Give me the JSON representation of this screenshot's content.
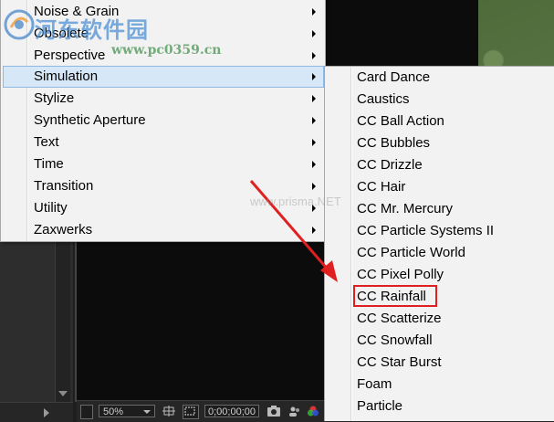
{
  "menu": {
    "items": [
      {
        "label": "Noise & Grain"
      },
      {
        "label": "Obsolete"
      },
      {
        "label": "Perspective"
      },
      {
        "label": "Simulation"
      },
      {
        "label": "Stylize"
      },
      {
        "label": "Synthetic Aperture"
      },
      {
        "label": "Text"
      },
      {
        "label": "Time"
      },
      {
        "label": "Transition"
      },
      {
        "label": "Utility"
      },
      {
        "label": "Zaxwerks"
      }
    ],
    "highlighted": "Simulation"
  },
  "submenu": {
    "items": [
      {
        "label": "Card Dance"
      },
      {
        "label": "Caustics"
      },
      {
        "label": "CC Ball Action"
      },
      {
        "label": "CC Bubbles"
      },
      {
        "label": "CC Drizzle"
      },
      {
        "label": "CC Hair"
      },
      {
        "label": "CC Mr. Mercury"
      },
      {
        "label": "CC Particle Systems II"
      },
      {
        "label": "CC Particle World"
      },
      {
        "label": "CC Pixel Polly"
      },
      {
        "label": "CC Rainfall"
      },
      {
        "label": "CC Scatterize"
      },
      {
        "label": "CC Snowfall"
      },
      {
        "label": "CC Star Burst"
      },
      {
        "label": "Foam"
      },
      {
        "label": "Particle"
      }
    ],
    "marked": "CC Rainfall"
  },
  "viewer_bar": {
    "zoom": "50%",
    "timecode": "0;00;00;00"
  },
  "watermark": {
    "title": "河东软件园",
    "url": "www.pc0359.cn",
    "faint": "www.prisma.NET"
  },
  "colors": {
    "highlight": "#d6e7f8",
    "marker": "#e02020"
  }
}
